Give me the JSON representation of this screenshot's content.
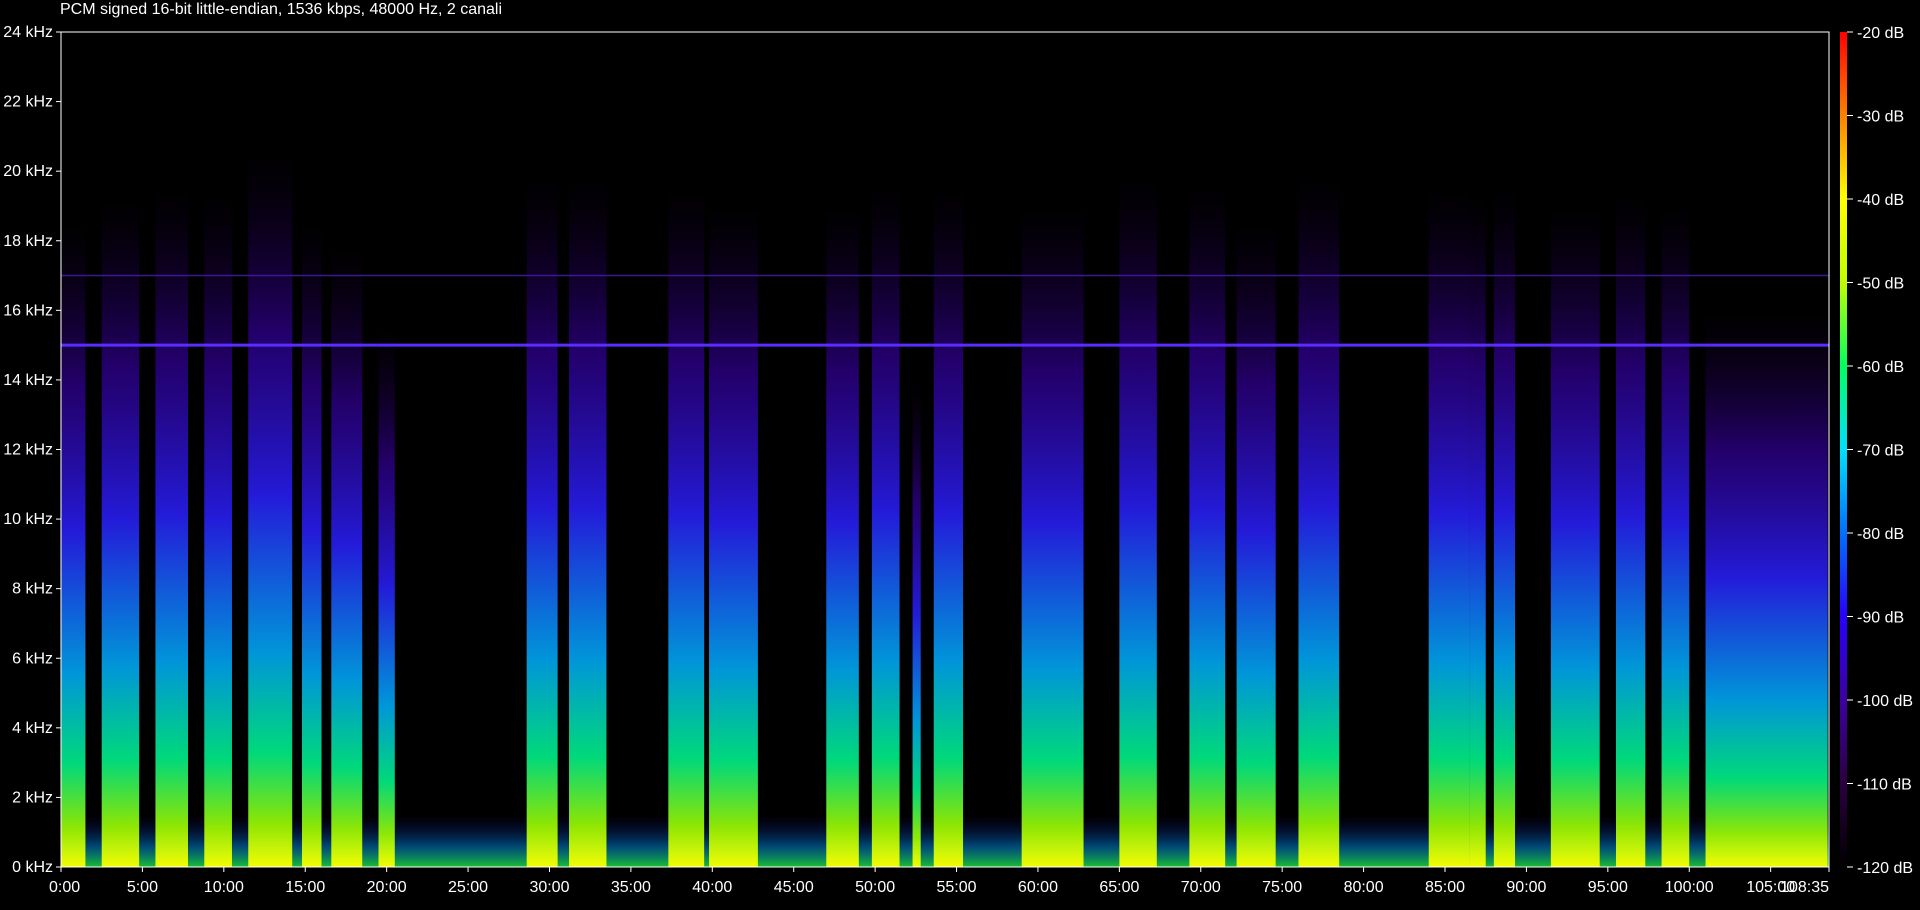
{
  "header": {
    "format_info": "PCM signed 16-bit little-endian, 1536 kbps, 48000 Hz, 2 canali"
  },
  "colors": {
    "background": "#000000",
    "axis": "#ffffff",
    "text": "#ffffff",
    "colormap": [
      "#000000",
      "#2a0040",
      "#3c00a0",
      "#2800ff",
      "#0070ff",
      "#00e0ff",
      "#00ff60",
      "#c0ff00",
      "#ffff00",
      "#ff8000",
      "#ff0000"
    ]
  },
  "chart_data": {
    "type": "heatmap",
    "title": "PCM signed 16-bit little-endian, 1536 kbps, 48000 Hz, 2 canali",
    "sample_rate_hz": 48000,
    "channels": 2,
    "bitrate": "1536 kbps",
    "x": {
      "unit": "minutes",
      "range": [
        0,
        108.583
      ],
      "ticks": [
        0,
        5,
        10,
        15,
        20,
        25,
        30,
        35,
        40,
        45,
        50,
        55,
        60,
        65,
        70,
        75,
        80,
        85,
        90,
        95,
        100,
        105,
        108.583
      ],
      "tick_labels": [
        "0:00",
        "5:00",
        "10:00",
        "15:00",
        "20:00",
        "25:00",
        "30:00",
        "35:00",
        "40:00",
        "45:00",
        "50:00",
        "55:00",
        "60:00",
        "65:00",
        "70:00",
        "75:00",
        "80:00",
        "85:00",
        "90:00",
        "95:00",
        "100:00",
        "105:00",
        "108:35"
      ]
    },
    "y": {
      "unit": "kHz",
      "range": [
        0,
        24
      ],
      "ticks": [
        0,
        2,
        4,
        6,
        8,
        10,
        12,
        14,
        16,
        18,
        20,
        22,
        24
      ],
      "tick_labels": [
        "0 kHz",
        "2 kHz",
        "4 kHz",
        "6 kHz",
        "8 kHz",
        "10 kHz",
        "12 kHz",
        "14 kHz",
        "16 kHz",
        "18 kHz",
        "20 kHz",
        "22 kHz",
        "24 kHz"
      ]
    },
    "colorbar": {
      "unit": "dB",
      "range": [
        -120,
        -20
      ],
      "ticks": [
        -20,
        -30,
        -40,
        -50,
        -60,
        -70,
        -80,
        -90,
        -100,
        -110,
        -120
      ],
      "tick_labels": [
        "-20 dB",
        "-30 dB",
        "-40 dB",
        "-50 dB",
        "-60 dB",
        "-70 dB",
        "-80 dB",
        "-90 dB",
        "-100 dB",
        "-110 dB",
        "-120 dB"
      ]
    },
    "horizontal_lines_khz": [
      15.0,
      17.0
    ],
    "loud_segments_min": [
      [
        0.0,
        1.5
      ],
      [
        2.5,
        4.8
      ],
      [
        5.8,
        7.8
      ],
      [
        8.8,
        10.5
      ],
      [
        11.5,
        14.2
      ],
      [
        14.8,
        16.0
      ],
      [
        16.6,
        18.5
      ],
      [
        19.5,
        20.5
      ],
      [
        28.6,
        30.5
      ],
      [
        31.2,
        33.5
      ],
      [
        37.3,
        39.5
      ],
      [
        39.8,
        42.8
      ],
      [
        47.0,
        49.0
      ],
      [
        49.8,
        51.5
      ],
      [
        52.3,
        52.8
      ],
      [
        53.6,
        55.4
      ],
      [
        59.0,
        62.8
      ],
      [
        65.0,
        67.3
      ],
      [
        69.3,
        71.5
      ],
      [
        72.2,
        74.6
      ],
      [
        76.0,
        78.5
      ],
      [
        84.0,
        86.5
      ],
      [
        86.5,
        87.5
      ],
      [
        88.0,
        89.3
      ],
      [
        91.5,
        94.5
      ],
      [
        95.5,
        97.3
      ],
      [
        98.3,
        100.0
      ],
      [
        101.0,
        108.5
      ]
    ]
  }
}
